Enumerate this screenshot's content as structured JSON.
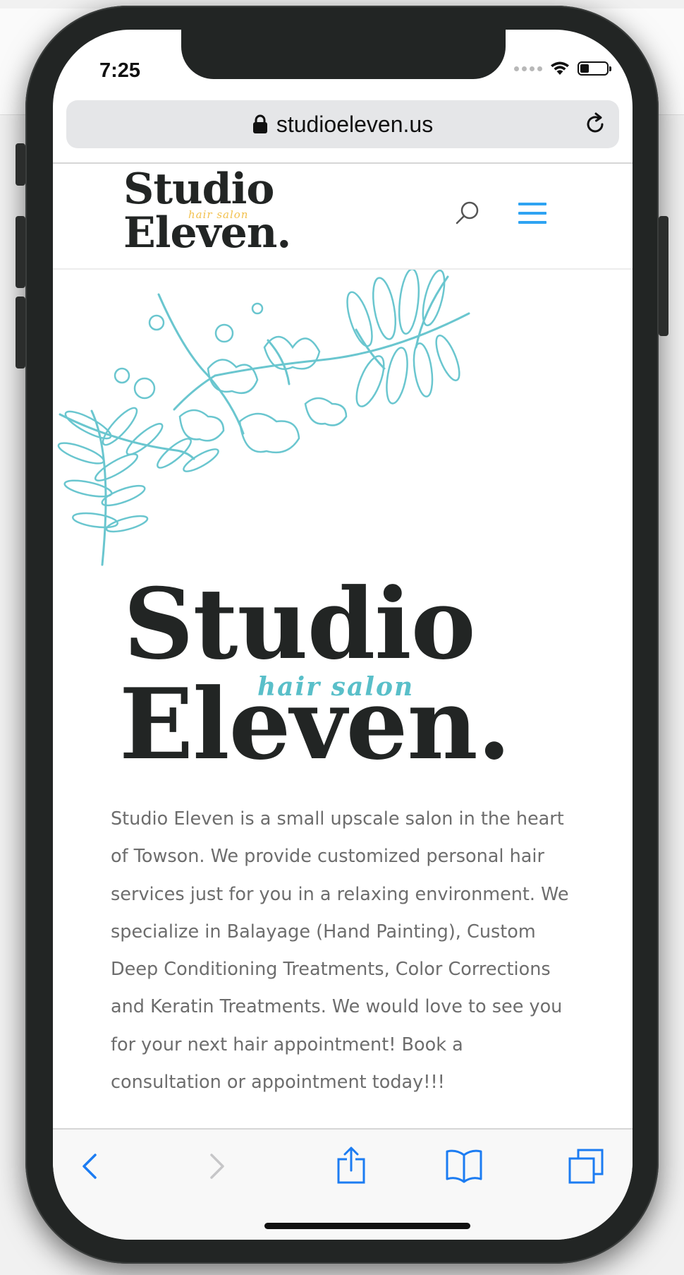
{
  "status_bar": {
    "time": "7:25"
  },
  "browser": {
    "url": "studioeleven.us"
  },
  "header": {
    "logo": {
      "line1": "Studio",
      "tagline": "hair salon",
      "line2": "Eleven."
    },
    "search_icon": "search-icon",
    "menu_icon": "hamburger-icon"
  },
  "hero": {
    "logo": {
      "line1": "Studio",
      "tagline": "hair salon",
      "line2": "Eleven."
    },
    "about": "Studio Eleven is a small upscale salon in the heart of Towson. We provide customized personal hair services just for you in a relaxing environment. We specialize in Balayage (Hand Painting),  Custom Deep Conditioning Treatments, Color Corrections and Keratin Treatments. We would love to see you for your next hair appointment! Book a consultation or appointment today!!!"
  },
  "toolbar": {
    "icons": [
      "back-icon",
      "forward-icon",
      "share-icon",
      "bookmarks-icon",
      "tabs-icon"
    ]
  },
  "colors": {
    "accent": "#2ea3f2",
    "floral": "#6ac6cf",
    "tagline_small": "#f2c14e",
    "tagline_big": "#59bfc9",
    "logo_text": "#222524",
    "body_text": "#6d6d6d",
    "ios_blue": "#1c7cf2"
  }
}
